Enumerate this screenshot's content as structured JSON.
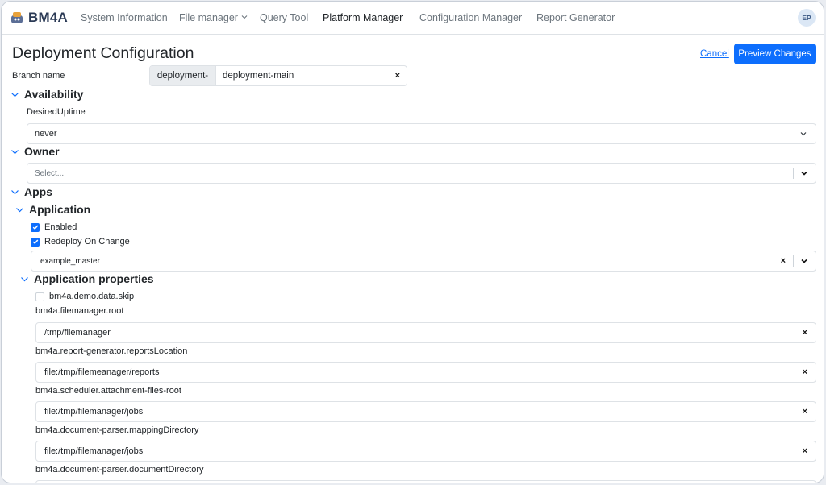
{
  "nav": {
    "brand": "BM4A",
    "items": [
      {
        "label": "System Information"
      },
      {
        "label": "File manager"
      },
      {
        "label": "Query Tool"
      },
      {
        "label": "Platform Manager"
      },
      {
        "label": "Configuration Manager"
      },
      {
        "label": "Report Generator"
      }
    ],
    "avatar": "EP",
    "active": "Platform Manager"
  },
  "page": {
    "title": "Deployment Configuration",
    "cancel_label": "Cancel",
    "preview_label": "Preview Changes"
  },
  "branch": {
    "label": "Branch name",
    "prefix": "deployment-",
    "value": "deployment-main",
    "clear": "×"
  },
  "availability": {
    "heading": "Availability",
    "field_label": "DesiredUptime",
    "value": "never"
  },
  "owner": {
    "heading": "Owner",
    "placeholder": "Select..."
  },
  "apps": {
    "heading": "Apps",
    "application": {
      "heading": "Application",
      "enabled_label": "Enabled",
      "enabled_checked": true,
      "redeploy_label": "Redeploy On Change",
      "redeploy_checked": true,
      "selected": "example_master",
      "clear": "×"
    },
    "properties": {
      "heading": "Application properties",
      "skip_label": "bm4a.demo.data.skip",
      "skip_checked": false,
      "fields": [
        {
          "label": "bm4a.filemanager.root",
          "value": "/tmp/filemanager"
        },
        {
          "label": "bm4a.report-generator.reportsLocation",
          "value": "file:/tmp/filemeanager/reports"
        },
        {
          "label": "bm4a.scheduler.attachment-files-root",
          "value": "file:/tmp/filemanager/jobs"
        },
        {
          "label": "bm4a.document-parser.mappingDirectory",
          "value": "file:/tmp/filemanager/jobs"
        },
        {
          "label": "bm4a.document-parser.documentDirectory",
          "value": ""
        }
      ],
      "clear": "×"
    }
  },
  "colors": {
    "primary": "#0d6efd",
    "brand": "#2b3a55",
    "border": "#dee2e6"
  }
}
